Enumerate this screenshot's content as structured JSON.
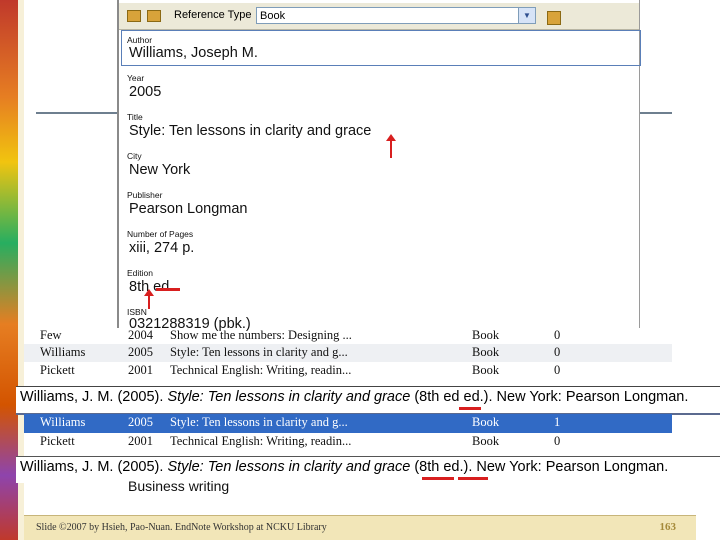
{
  "form": {
    "reference_type_label": "Reference Type",
    "reference_type_value": "Book",
    "fields": {
      "author_label": "Author",
      "author_value": "Williams, Joseph M.",
      "year_label": "Year",
      "year_value": "2005",
      "title_label": "Title",
      "title_value": "Style: Ten lessons in clarity and grace",
      "city_label": "City",
      "city_value": "New York",
      "publisher_label": "Publisher",
      "publisher_value": "Pearson Longman",
      "pages_label": "Number of Pages",
      "pages_value": "xiii, 274 p.",
      "edition_label": "Edition",
      "edition_value": "8th ed.",
      "isbn_label": "ISBN",
      "isbn_value": "0321288319 (pbk.)"
    }
  },
  "list_top": {
    "rows": [
      {
        "author": "Few",
        "year": "2004",
        "title": "Show me the numbers: Designing ...",
        "type": "Book",
        "n": "0"
      },
      {
        "author": "Williams",
        "year": "2005",
        "title": "Style: Ten lessons in clarity and g...",
        "type": "Book",
        "n": "0"
      },
      {
        "author": "Pickett",
        "year": "2001",
        "title": "Technical English: Writing, readin...",
        "type": "Book",
        "n": "0"
      }
    ]
  },
  "citation_before": "Williams, J. M. (2005). Style: Ten lessons in clarity and grace (8th ed ed.). New York: Pearson Longman.",
  "citation_before_parts": {
    "pre": "Williams, J. M. (2005). ",
    "title": "Style: Ten lessons in clarity and grace",
    "post": " (8th ed ed.). New York: Pearson Longman."
  },
  "list_selected": {
    "rows": [
      {
        "author": "Williams",
        "year": "2005",
        "title": "Style: Ten lessons in clarity and g...",
        "type": "Book",
        "n": "1"
      },
      {
        "author": "Pickett",
        "year": "2001",
        "title": "Technical English: Writing, readin...",
        "type": "Book",
        "n": "0"
      }
    ]
  },
  "citation_after_parts": {
    "pre": "Williams, J. M. (2005). ",
    "title": "Style: Ten lessons in clarity and grace",
    "post": " (8th ed.). New York: Pearson Longman."
  },
  "bottom_list": [
    "Business writing"
  ],
  "footer": {
    "text": "Slide ©2007 by Hsieh, Pao-Nuan. EndNote Workshop at NCKU Library",
    "page": "163"
  },
  "colors": {
    "selection": "#316ac5",
    "annotation_red": "#d81f1f",
    "footer_bg": "#f2e6b8"
  }
}
